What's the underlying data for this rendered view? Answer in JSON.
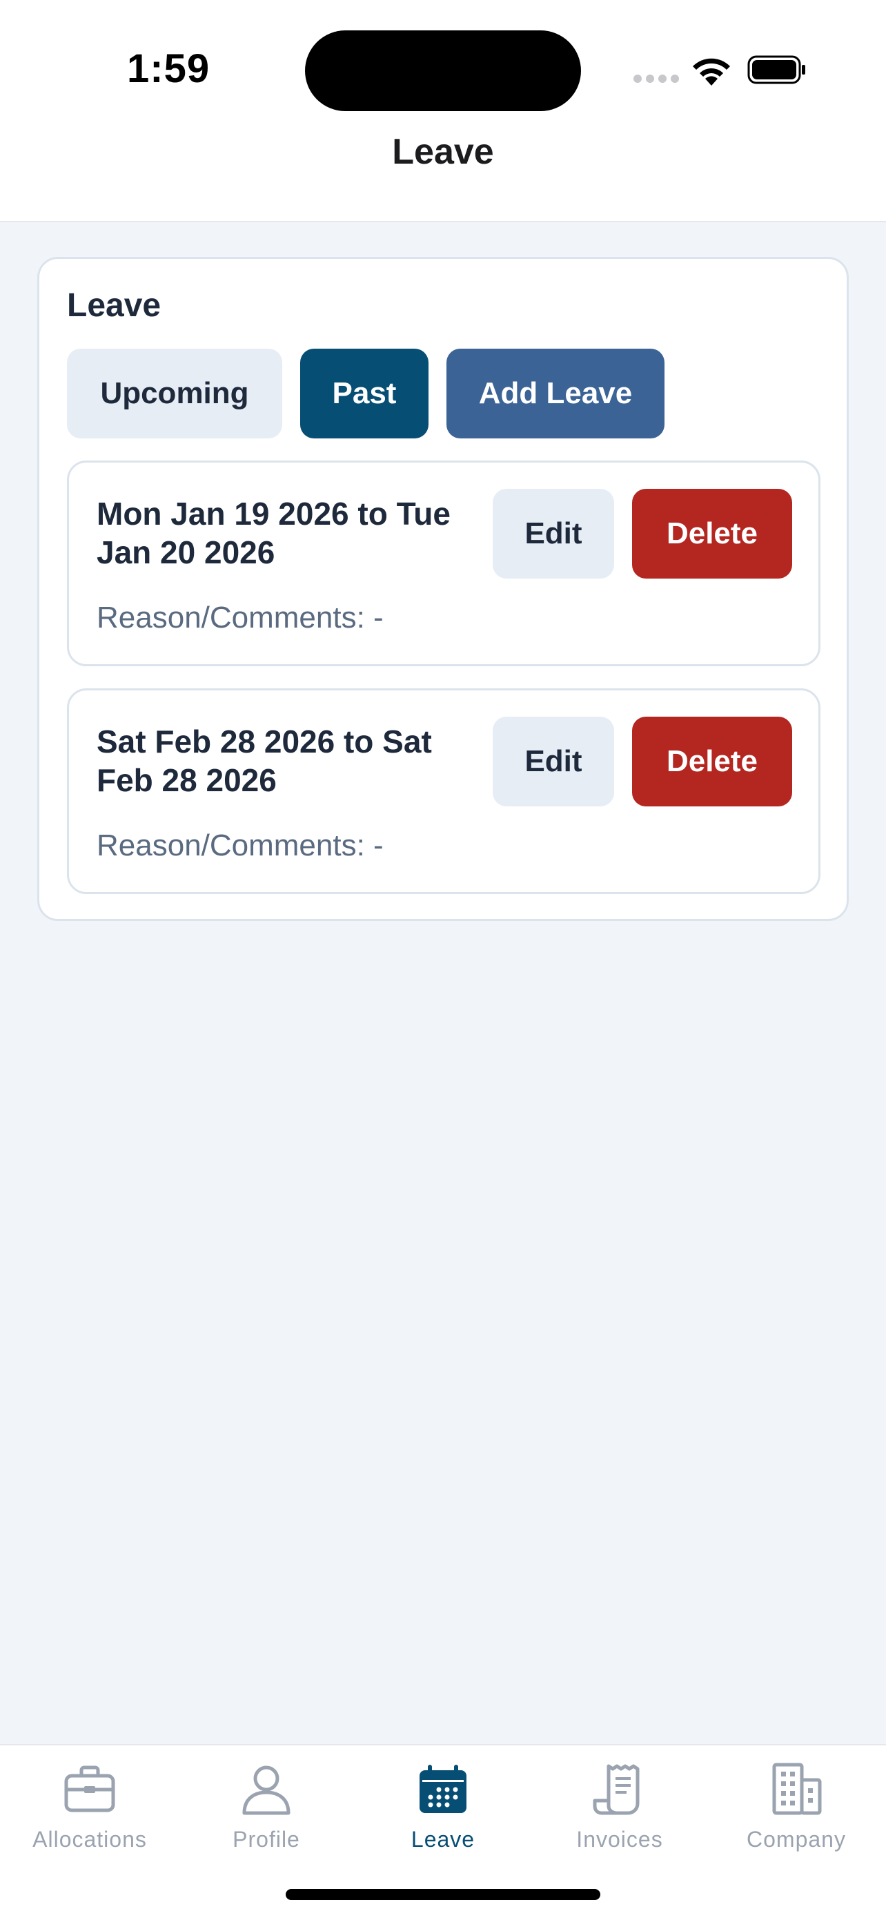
{
  "status_bar": {
    "time": "1:59"
  },
  "nav": {
    "title": "Leave"
  },
  "card": {
    "title": "Leave",
    "buttons": {
      "upcoming": "Upcoming",
      "past": "Past",
      "add": "Add Leave"
    }
  },
  "leave_items": [
    {
      "dates": "Mon Jan 19 2026 to Tue Jan 20 2026",
      "reason": "Reason/Comments: -",
      "edit_label": "Edit",
      "delete_label": "Delete"
    },
    {
      "dates": "Sat Feb 28 2026 to Sat Feb 28 2026",
      "reason": "Reason/Comments: -",
      "edit_label": "Edit",
      "delete_label": "Delete"
    }
  ],
  "tabs": [
    {
      "label": "Allocations",
      "icon": "briefcase-icon",
      "active": false
    },
    {
      "label": "Profile",
      "icon": "person-icon",
      "active": false
    },
    {
      "label": "Leave",
      "icon": "calendar-icon",
      "active": true
    },
    {
      "label": "Invoices",
      "icon": "receipt-icon",
      "active": false
    },
    {
      "label": "Company",
      "icon": "building-icon",
      "active": false
    }
  ],
  "colors": {
    "primary": "#064e73",
    "add_button": "#3b6396",
    "danger": "#b42620",
    "background": "#f1f5f9",
    "inactive_tab": "#9aa3af"
  }
}
